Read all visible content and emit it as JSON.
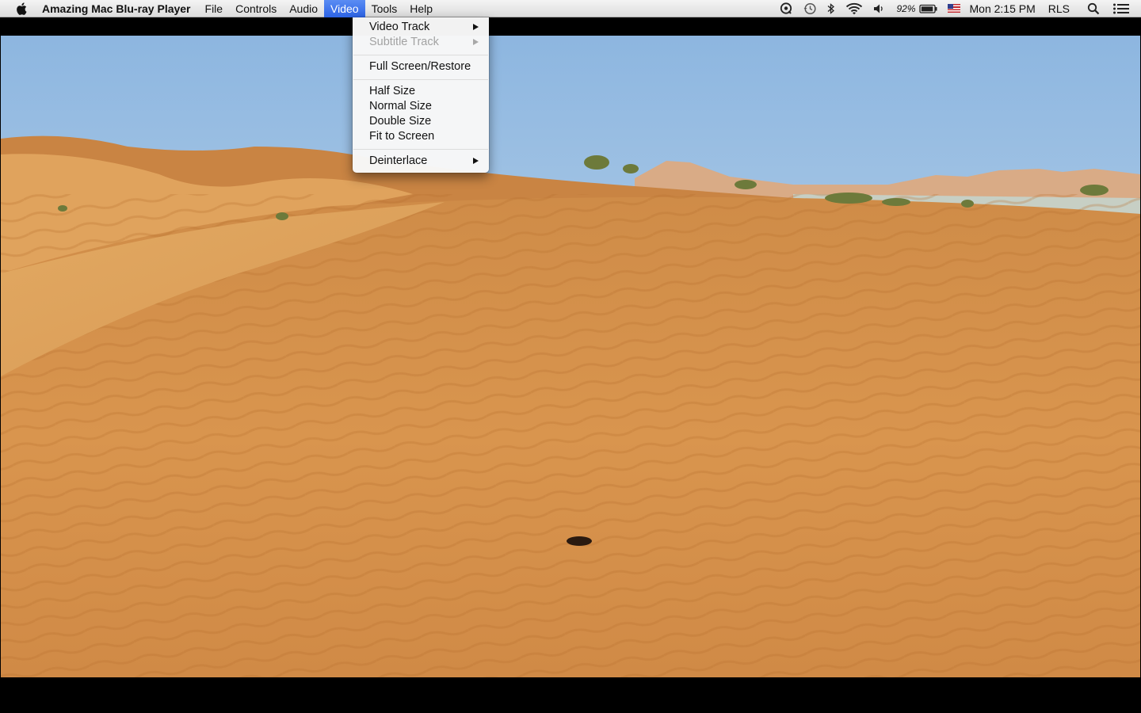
{
  "menubar": {
    "app_name": "Amazing Mac Blu-ray Player",
    "menus": [
      "File",
      "Controls",
      "Audio",
      "Video",
      "Tools",
      "Help"
    ],
    "active_menu": "Video",
    "status": {
      "battery_percent": "92%",
      "clock": "Mon 2:15 PM",
      "user": "RLS",
      "icons": [
        "quicktime-icon",
        "time-machine-icon",
        "bluetooth-icon",
        "wifi-icon",
        "volume-icon",
        "battery-icon",
        "us-flag-icon",
        "spotlight-icon",
        "notification-center-icon"
      ]
    }
  },
  "video_menu": {
    "items": {
      "video_track": "Video Track",
      "subtitle_track": "Subtitle Track",
      "full_screen": "Full Screen/Restore",
      "half_size": "Half Size",
      "normal_size": "Normal Size",
      "double_size": "Double Size",
      "fit_to_screen": "Fit to Screen",
      "deinterlace": "Deinterlace"
    },
    "disabled": [
      "Subtitle Track"
    ],
    "submenus": [
      "Video Track",
      "Subtitle Track",
      "Deinterlace"
    ]
  },
  "colors": {
    "menu_highlight": "#3b74ec",
    "sky": "#a9c8e6",
    "sand": "#d9954e"
  }
}
